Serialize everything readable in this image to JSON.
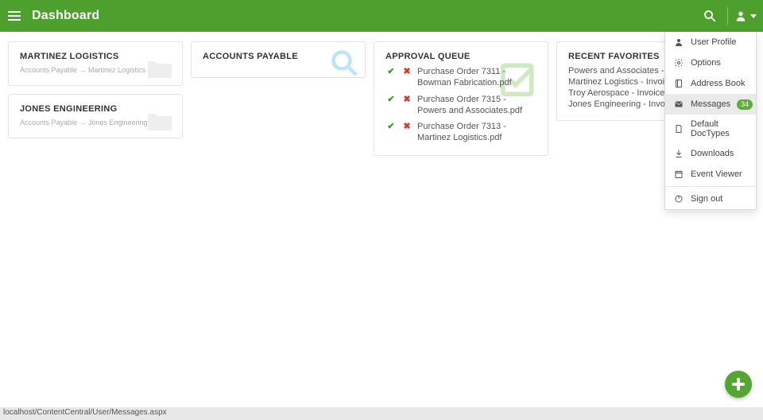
{
  "header": {
    "title": "Dashboard"
  },
  "cards": {
    "martinez": {
      "title": "MARTINEZ LOGISTICS",
      "crumb": "Accounts Payable → Martinez Logistics"
    },
    "jones": {
      "title": "JONES ENGINEERING",
      "crumb": "Accounts Payable → Jones Engineering"
    },
    "ap": {
      "title": "ACCOUNTS PAYABLE"
    },
    "approval": {
      "title": "APPROVAL QUEUE",
      "items": [
        "Purchase Order 7311 - Bowman Fabrication.pdf",
        "Purchase Order 7315 - Powers and Associates.pdf",
        "Purchase Order 7313 - Martinez Logistics.pdf"
      ]
    },
    "favorites": {
      "title": "RECENT FAVORITES",
      "items": [
        "Powers and Associates - Invoice 4…",
        "Martinez Logistics - Invoice 4803.…",
        "Troy Aerospace - Invoice 4806.pdf",
        "Jones Engineering - Invoice 4802.…"
      ]
    }
  },
  "user_menu": {
    "profile": "User Profile",
    "options": "Options",
    "address_book": "Address Book",
    "messages": "Messages",
    "messages_badge": "34",
    "default_doctypes": "Default DocTypes",
    "downloads": "Downloads",
    "event_viewer": "Event Viewer",
    "sign_out": "Sign out"
  },
  "status": "localhost/ContentCentral/User/Messages.aspx"
}
